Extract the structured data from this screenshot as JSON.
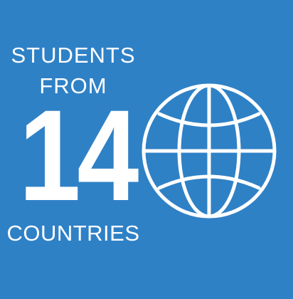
{
  "tile": {
    "line_1": "STUDENTS",
    "line_2": "FROM",
    "number": "14",
    "line_3": "COUNTRIES",
    "icon": "globe-icon",
    "background_color": "#2f81c6",
    "foreground_color": "#ffffff"
  }
}
